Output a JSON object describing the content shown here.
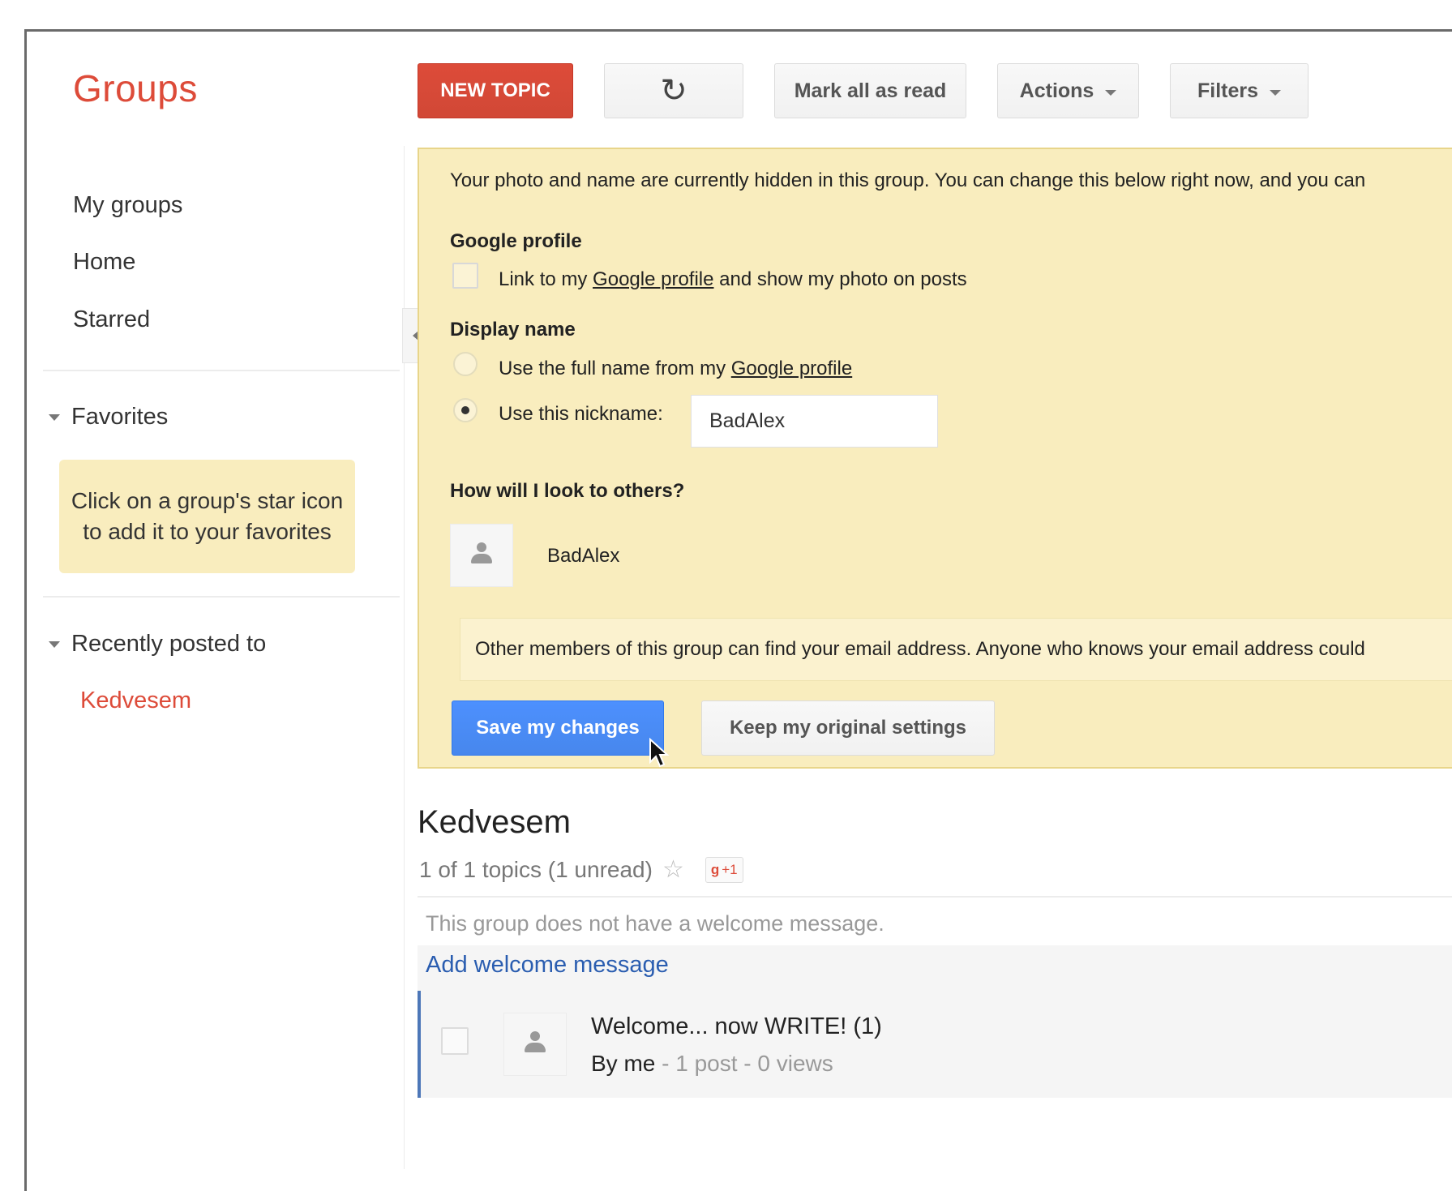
{
  "app": {
    "logo": "Groups"
  },
  "toolbar": {
    "new_topic": "NEW TOPIC",
    "refresh_icon": "refresh-icon",
    "mark_all_read": "Mark all as read",
    "actions": "Actions",
    "filters": "Filters"
  },
  "sidebar": {
    "items": [
      {
        "label": "My groups"
      },
      {
        "label": "Home"
      },
      {
        "label": "Starred"
      }
    ],
    "favorites": {
      "label": "Favorites",
      "note": "Click on a group's star icon to add it to your favorites"
    },
    "recent": {
      "label": "Recently posted to",
      "items": [
        {
          "label": "Kedvesem"
        }
      ]
    }
  },
  "notice": {
    "intro": "Your photo and name are currently hidden in this group. You can change this below right now, and you can",
    "google_profile_heading": "Google profile",
    "link_profile": {
      "before": "Link to my ",
      "link": "Google profile",
      "after": " and show my photo on posts",
      "checked": false
    },
    "display_name_heading": "Display name",
    "option_full_name": {
      "before": "Use the full name from my ",
      "link": "Google profile",
      "selected": false
    },
    "option_nickname": {
      "label": "Use this nickname:",
      "selected": true
    },
    "nickname_value": "BadAlex",
    "preview_heading": "How will I look to others?",
    "preview_name": "BadAlex",
    "email_note": "Other members of this group can find your email address. Anyone who knows your email address could",
    "save_button": "Save my changes",
    "keep_button": "Keep my original settings"
  },
  "group": {
    "title": "Kedvesem",
    "meta": "1 of 1 topics (1 unread)",
    "star_icon": "☆",
    "gplus": "+1",
    "welcome_message": "This group does not have a welcome message.",
    "add_welcome": "Add welcome message"
  },
  "topics": [
    {
      "title": "Welcome... now WRITE!  (1)",
      "author": "By me",
      "stats": " - 1 post - 0 views"
    }
  ],
  "colors": {
    "brand_red": "#dd4b39",
    "notice_yellow": "#f9edbe",
    "primary_blue": "#4d90fe",
    "link_blue": "#2a5db0"
  }
}
